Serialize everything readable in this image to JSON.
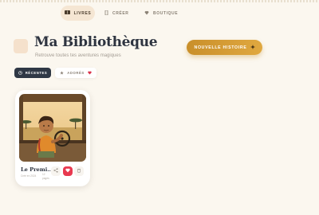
{
  "nav": {
    "items": [
      {
        "label": "LIVRES",
        "icon": "book-icon",
        "active": true
      },
      {
        "label": "CRÉER",
        "icon": "pen-icon",
        "active": false
      },
      {
        "label": "BOUTIQUE",
        "icon": "shop-icon",
        "active": false
      }
    ]
  },
  "header": {
    "title": "Ma Bibliothèque",
    "subtitle": "Retrouve toutes tes aventures magiques",
    "new_story_label": "NOUVELLE HISTOIRE",
    "new_story_icon": "sparkle-icon"
  },
  "filters": {
    "recent_label": "RÉCENTES",
    "loved_label": "ADORÉS"
  },
  "book_card": {
    "title": "Le Premi...",
    "meta_left": "Créé en 2024",
    "meta_right_1": "12",
    "meta_right_2": "pages"
  },
  "colors": {
    "background": "#fbf7ef",
    "accent": "#d69a33",
    "dark_pill": "#2f3845",
    "favorite": "#e8394f"
  }
}
